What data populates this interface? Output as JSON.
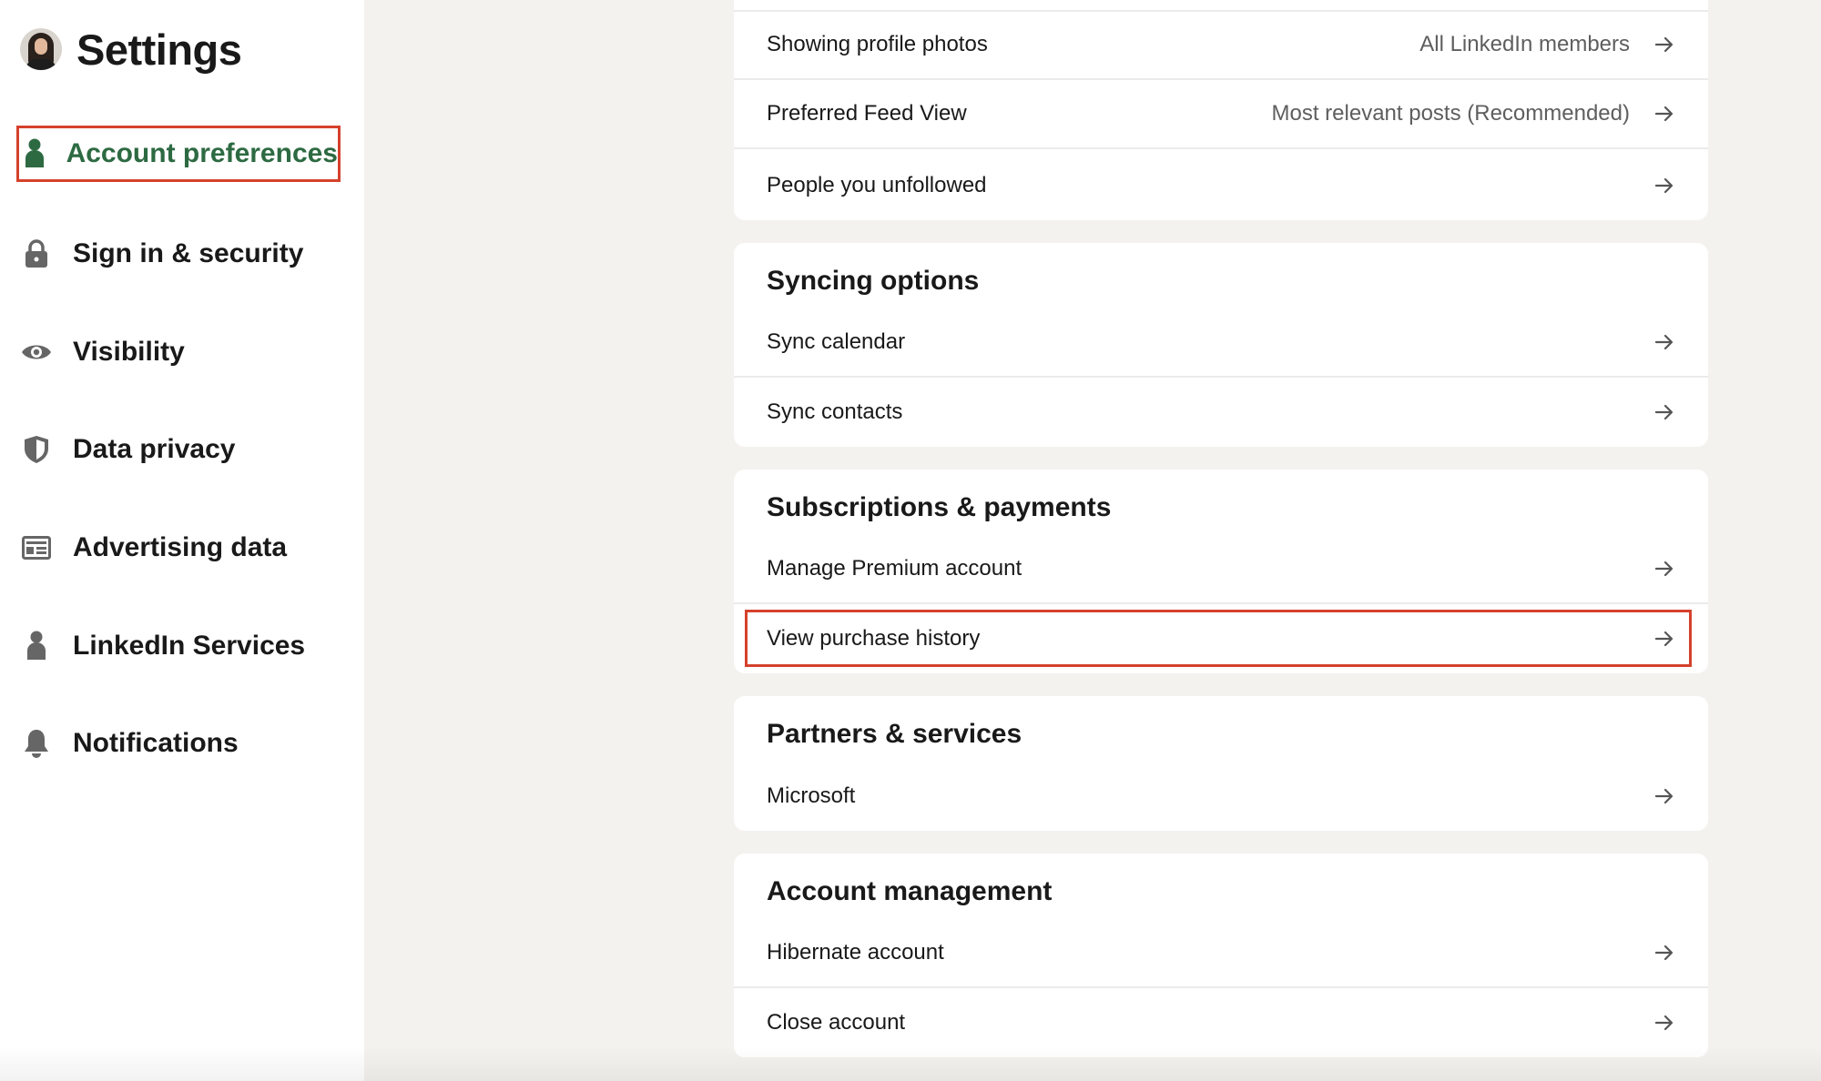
{
  "sidebar": {
    "title": "Settings",
    "items": [
      {
        "label": "Account preferences",
        "icon": "person-icon",
        "active": true
      },
      {
        "label": "Sign in & security",
        "icon": "lock-icon"
      },
      {
        "label": "Visibility",
        "icon": "eye-icon"
      },
      {
        "label": "Data privacy",
        "icon": "shield-icon"
      },
      {
        "label": "Advertising data",
        "icon": "ad-icon"
      },
      {
        "label": "LinkedIn Services",
        "icon": "person-icon"
      },
      {
        "label": "Notifications",
        "icon": "bell-icon"
      }
    ]
  },
  "main": {
    "general": {
      "rows": [
        {
          "label": "Showing profile photos",
          "value": "All LinkedIn members"
        },
        {
          "label": "Preferred Feed View",
          "value": "Most relevant posts (Recommended)"
        },
        {
          "label": "People you unfollowed",
          "value": ""
        }
      ]
    },
    "syncing": {
      "title": "Syncing options",
      "rows": [
        {
          "label": "Sync calendar"
        },
        {
          "label": "Sync contacts"
        }
      ]
    },
    "subscriptions": {
      "title": "Subscriptions & payments",
      "rows": [
        {
          "label": "Manage Premium account"
        },
        {
          "label": "View purchase history"
        }
      ]
    },
    "partners": {
      "title": "Partners & services",
      "rows": [
        {
          "label": "Microsoft"
        }
      ]
    },
    "account_management": {
      "title": "Account management",
      "rows": [
        {
          "label": "Hibernate account"
        },
        {
          "label": "Close account"
        }
      ]
    }
  },
  "colors": {
    "accent_green": "#2d6a42",
    "highlight_red": "#d5412c",
    "page_background": "#f4f2ee"
  }
}
